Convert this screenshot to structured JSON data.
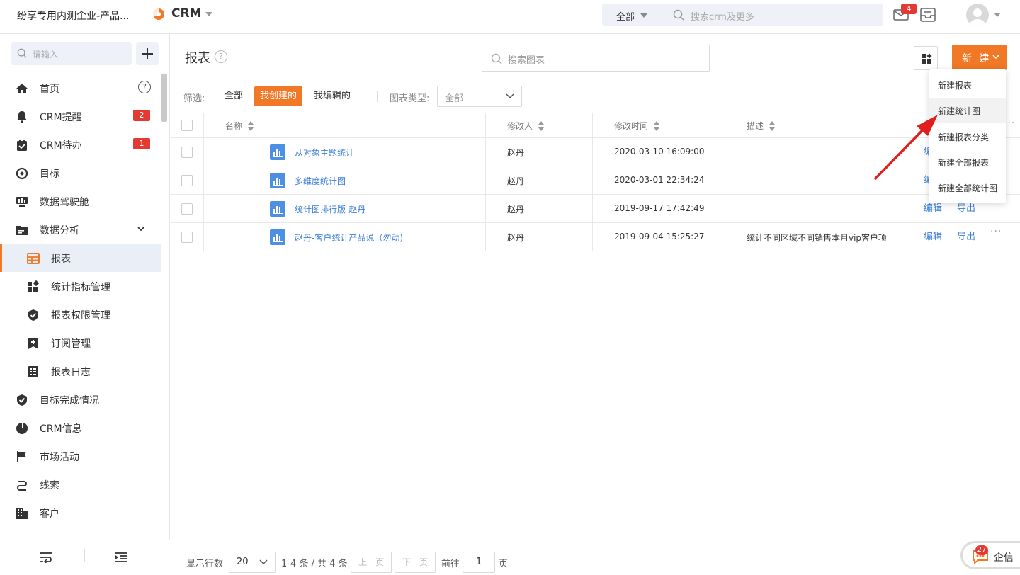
{
  "topbar": {
    "company": "纷享专用内测企业-产品...",
    "app_name": "CRM",
    "search_scope": "全部",
    "search_placeholder": "搜索crm及更多",
    "mail_badge": "4"
  },
  "sidebar": {
    "search_placeholder": "请输入",
    "items": [
      {
        "label": "首页",
        "icon": "home-icon"
      },
      {
        "label": "CRM提醒",
        "icon": "bell-icon",
        "badge": "2"
      },
      {
        "label": "CRM待办",
        "icon": "todo-icon",
        "badge": "1"
      },
      {
        "label": "目标",
        "icon": "target-icon"
      },
      {
        "label": "数据驾驶舱",
        "icon": "cockpit-icon"
      },
      {
        "label": "数据分析",
        "icon": "folder-icon"
      },
      {
        "label": "报表",
        "icon": "report-icon"
      },
      {
        "label": "统计指标管理",
        "icon": "widgets-icon"
      },
      {
        "label": "报表权限管理",
        "icon": "shield-icon"
      },
      {
        "label": "订阅管理",
        "icon": "bookmark-add-icon"
      },
      {
        "label": "报表日志",
        "icon": "list-icon"
      },
      {
        "label": "目标完成情况",
        "icon": "check-shield-icon"
      },
      {
        "label": "CRM信息",
        "icon": "pie-icon"
      },
      {
        "label": "市场活动",
        "icon": "flag-icon"
      },
      {
        "label": "线索",
        "icon": "route-icon"
      },
      {
        "label": "客户",
        "icon": "building-icon"
      }
    ]
  },
  "main": {
    "title": "报表",
    "search_placeholder": "搜索图表",
    "new_button": "新 建",
    "filter_label": "筛选:",
    "filters": [
      "全部",
      "我创建的",
      "我编辑的"
    ],
    "type_label": "图表类型:",
    "type_value": "全部"
  },
  "table": {
    "columns": [
      "名称",
      "修改人",
      "修改时间",
      "描述"
    ],
    "rows": [
      {
        "name": "从对象主题统计",
        "modifier": "赵丹",
        "time": "2020-03-10 16:09:00",
        "desc": ""
      },
      {
        "name": "多维度统计图",
        "modifier": "赵丹",
        "time": "2020-03-01 22:34:24",
        "desc": ""
      },
      {
        "name": "统计图排行版-赵丹",
        "modifier": "赵丹",
        "time": "2019-09-17 17:42:49",
        "desc": ""
      },
      {
        "name": "赵丹-客户统计产品说（勿动)",
        "modifier": "赵丹",
        "time": "2019-09-04 15:25:27",
        "desc": "统计不同区域不同销售本月vip客户项"
      }
    ],
    "actions": {
      "edit": "编辑",
      "export": "导出",
      "more": "···"
    }
  },
  "dropdown": {
    "items": [
      "新建报表",
      "新建统计图",
      "新建报表分类",
      "新建全部报表",
      "新建全部统计图"
    ]
  },
  "pager": {
    "rows_label": "显示行数",
    "page_size": "20",
    "summary": "1-4 条 / 共 4 条",
    "prev": "上一页",
    "next": "下一页",
    "goto": "前往",
    "page": "1",
    "page_unit": "页"
  },
  "qixin": {
    "label": "企信",
    "badge": "27"
  },
  "colors": {
    "accent": "#f07826",
    "link": "#3c7fd8",
    "badge": "#e53a33"
  }
}
